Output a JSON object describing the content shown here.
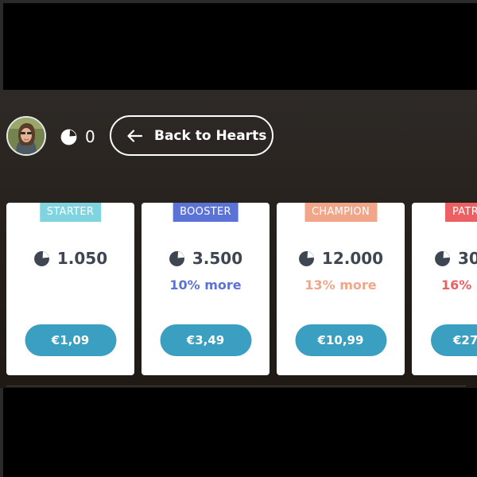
{
  "header": {
    "balance": "0",
    "back_label": "Back to Hearts"
  },
  "colors": {
    "starter": "#7fd4e0",
    "booster": "#5b73d6",
    "champion": "#f1a689",
    "patron": "#ec5f63",
    "buy_button": "#3b9fc1",
    "amount_text": "#3d4651"
  },
  "icons": {
    "gem": "heart-gem-icon",
    "back": "arrow-left-icon"
  },
  "packs": [
    {
      "tag": "STARTER",
      "amount": "1.050",
      "bonus": "",
      "price": "€1,09"
    },
    {
      "tag": "BOOSTER",
      "amount": "3.500",
      "bonus": "10% more",
      "price": "€3,49"
    },
    {
      "tag": "CHAMPION",
      "amount": "12.000",
      "bonus": "13% more",
      "price": "€10,99"
    },
    {
      "tag": "PATR",
      "amount": "30",
      "bonus": "16% m",
      "price": "€27"
    }
  ]
}
